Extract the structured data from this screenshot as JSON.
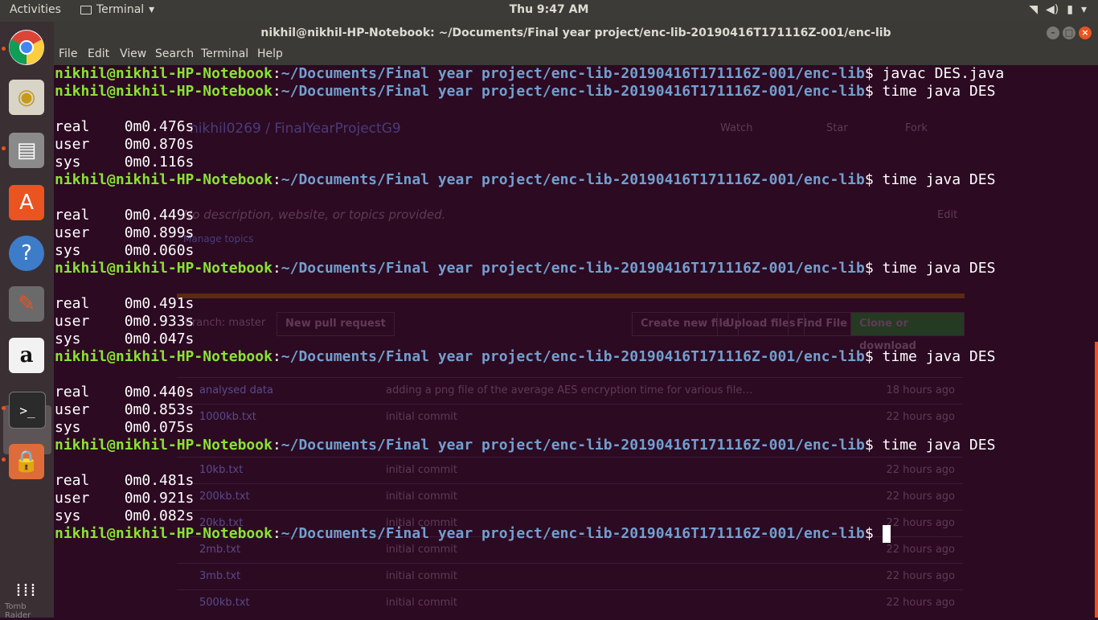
{
  "topbar": {
    "activities": "Activities",
    "app_name": "Terminal",
    "clock": "Thu  9:47 AM",
    "status_icons": [
      "wifi-icon",
      "volume-icon",
      "battery-icon",
      "power-menu-icon"
    ]
  },
  "dock": {
    "items": [
      {
        "name": "chrome",
        "icon": "chrome-icon"
      },
      {
        "name": "rhythmbox",
        "icon": "speaker-icon"
      },
      {
        "name": "files",
        "icon": "file-cabinet-icon"
      },
      {
        "name": "software",
        "icon": "shopping-bag-icon"
      },
      {
        "name": "help",
        "icon": "help-icon"
      },
      {
        "name": "settings",
        "icon": "tools-icon"
      },
      {
        "name": "amazon",
        "icon": "amazon-icon"
      },
      {
        "name": "terminal",
        "icon": "terminal-icon"
      },
      {
        "name": "tomb-raider",
        "icon": "folder-lock-icon"
      },
      {
        "name": "show-apps",
        "icon": "app-grid-icon"
      }
    ],
    "watermark": "Tomb Raider"
  },
  "window": {
    "title": "nikhil@nikhil-HP-Notebook: ~/Documents/Final year project/enc-lib-20190416T171116Z-001/enc-lib",
    "menu": [
      "File",
      "Edit",
      "View",
      "Search",
      "Terminal",
      "Help"
    ]
  },
  "terminal": {
    "prompt_user": "nikhil@nikhil-HP-Notebook",
    "prompt_path": "~/Documents/Final year project/enc-lib-20190416T171116Z-001/enc-lib",
    "commands": [
      "javac DES.java",
      "time java DES",
      "time java DES",
      "time java DES",
      "time java DES",
      "time java DES"
    ],
    "runs": [
      {
        "real": "0m0.476s",
        "user": "0m0.870s",
        "sys": "0m0.116s"
      },
      {
        "real": "0m0.449s",
        "user": "0m0.899s",
        "sys": "0m0.060s"
      },
      {
        "real": "0m0.491s",
        "user": "0m0.933s",
        "sys": "0m0.047s"
      },
      {
        "real": "0m0.440s",
        "user": "0m0.853s",
        "sys": "0m0.075s"
      },
      {
        "real": "0m0.481s",
        "user": "0m0.921s",
        "sys": "0m0.082s"
      }
    ],
    "labels": {
      "real": "real",
      "user": "user",
      "sys": "sys"
    }
  },
  "background_browser": {
    "repo": "nikhil0269 / FinalYearProjectG9",
    "buttons": {
      "watch": "Watch",
      "star": "Star",
      "fork": "Fork",
      "edit": "Edit"
    },
    "description": "No description, website, or topics provided.",
    "manage_topics": "Manage topics",
    "branch_controls": [
      "Branch: master",
      "New pull request",
      "Create new file",
      "Upload files",
      "Find File",
      "Clone or download"
    ],
    "files": [
      {
        "name": "analysed data",
        "message": "adding a png file of the average AES encryption time for various file…",
        "age": "18 hours ago"
      },
      {
        "name": "1000kb.txt",
        "message": "initial commit",
        "age": "22 hours ago"
      },
      {
        "name": "10kb.txt",
        "message": "initial commit",
        "age": "22 hours ago"
      },
      {
        "name": "200kb.txt",
        "message": "initial commit",
        "age": "22 hours ago"
      },
      {
        "name": "20kb.txt",
        "message": "initial commit",
        "age": "22 hours ago"
      },
      {
        "name": "2mb.txt",
        "message": "initial commit",
        "age": "22 hours ago"
      },
      {
        "name": "3mb.txt",
        "message": "initial commit",
        "age": "22 hours ago"
      },
      {
        "name": "500kb.txt",
        "message": "initial commit",
        "age": "22 hours ago"
      }
    ]
  }
}
